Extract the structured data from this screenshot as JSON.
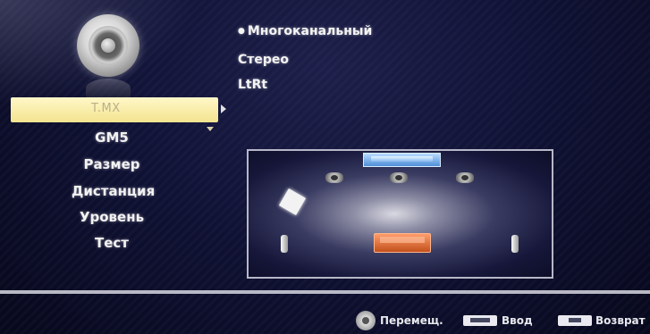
{
  "menu": {
    "selected_label": "T.MX",
    "items": [
      "GM5",
      "Размер",
      "Дистанция",
      "Уровень",
      "Тест"
    ]
  },
  "options": {
    "items": [
      "Многоканальный",
      "Стерео",
      "LtRt"
    ],
    "selected_index": 0
  },
  "footer": {
    "move_label": "Перемещ.",
    "enter_label": "Ввод",
    "return_label": "Возврат"
  },
  "icons": {
    "main": "speaker-icon",
    "nav": "dpad-icon",
    "enter": "enter-key-icon",
    "return": "return-key-icon"
  },
  "colors": {
    "highlight": "#f3e48f",
    "background": "#101236",
    "sofa": "#c2501c",
    "tv": "#4f8fd8"
  }
}
